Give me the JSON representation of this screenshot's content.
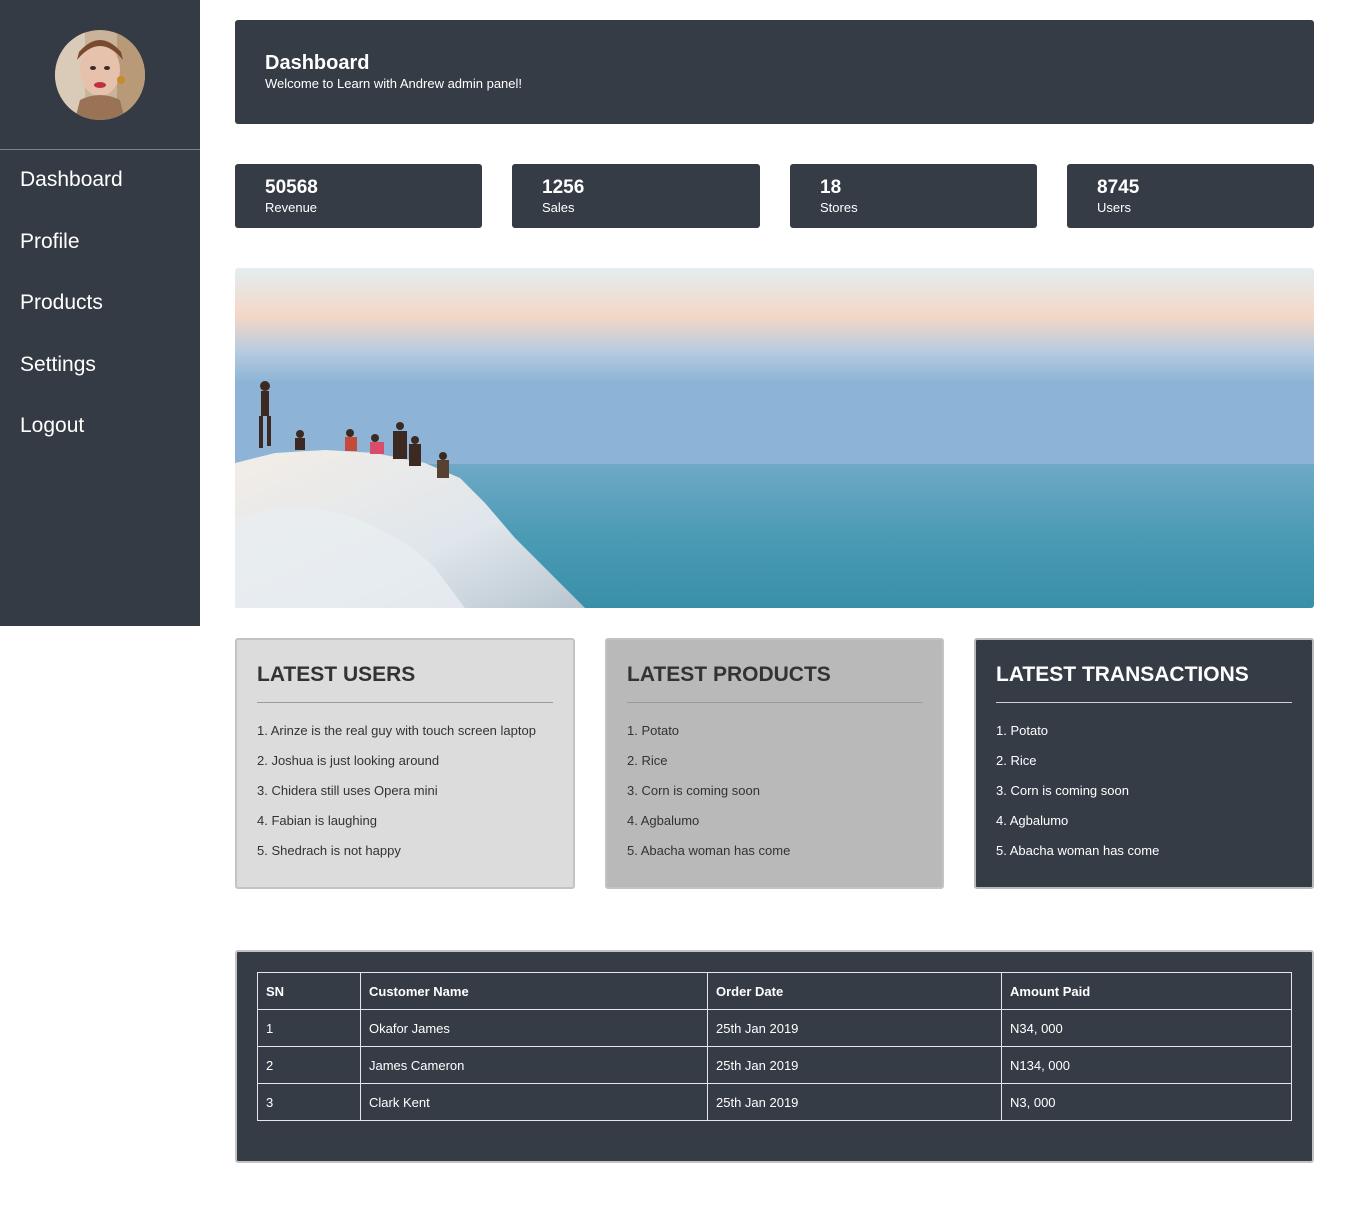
{
  "sidebar": {
    "avatar_alt": "avatar",
    "items": [
      {
        "label": "Dashboard"
      },
      {
        "label": "Profile"
      },
      {
        "label": "Products"
      },
      {
        "label": "Settings"
      },
      {
        "label": "Logout"
      }
    ]
  },
  "header": {
    "title": "Dashboard",
    "subtitle": "Welcome to Learn with Andrew admin panel!"
  },
  "stats": [
    {
      "value": "50568",
      "label": "Revenue"
    },
    {
      "value": "1256",
      "label": "Sales"
    },
    {
      "value": "18",
      "label": "Stores"
    },
    {
      "value": "8745",
      "label": "Users"
    }
  ],
  "panels": {
    "users": {
      "title": "LATEST USERS",
      "items": [
        "1. Arinze is the real guy with touch screen laptop",
        "2. Joshua is just looking around",
        "3. Chidera still uses Opera mini",
        "4. Fabian is laughing",
        "5. Shedrach is not happy"
      ]
    },
    "products": {
      "title": "LATEST PRODUCTS",
      "items": [
        "1. Potato",
        "2. Rice",
        "3. Corn is coming soon",
        "4. Agbalumo",
        "5. Abacha woman has come"
      ]
    },
    "transactions": {
      "title": "LATEST TRANSACTIONS",
      "items": [
        "1. Potato",
        "2. Rice",
        "3. Corn is coming soon",
        "4. Agbalumo",
        "5. Abacha woman has come"
      ]
    }
  },
  "orders_table": {
    "headers": [
      "SN",
      "Customer Name",
      "Order Date",
      "Amount Paid"
    ],
    "rows": [
      [
        "1",
        "Okafor James",
        "25th Jan 2019",
        "N34, 000"
      ],
      [
        "2",
        "James Cameron",
        "25th Jan 2019",
        "N134, 000"
      ],
      [
        "3",
        "Clark Kent",
        "25th Jan 2019",
        "N3, 000"
      ]
    ]
  },
  "colors": {
    "sidebar_bg": "#343b45",
    "card_dark": "#353c46",
    "panel_light": "#dcdcdc",
    "panel_mid": "#b9b9b9"
  }
}
